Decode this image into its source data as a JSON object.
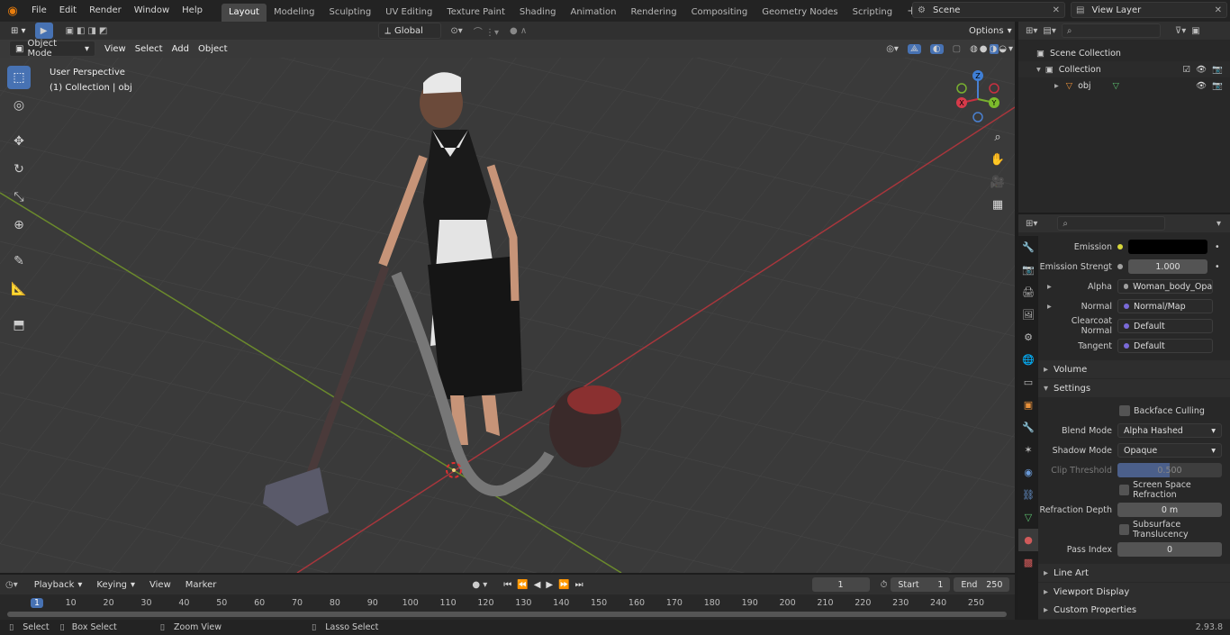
{
  "menubar": {
    "items": [
      "File",
      "Edit",
      "Render",
      "Window",
      "Help"
    ],
    "workspaces": [
      "Layout",
      "Modeling",
      "Sculpting",
      "UV Editing",
      "Texture Paint",
      "Shading",
      "Animation",
      "Rendering",
      "Compositing",
      "Geometry Nodes",
      "Scripting"
    ],
    "active_workspace": "Layout",
    "scene": "Scene",
    "view_layer": "View Layer"
  },
  "viewport": {
    "mode": "Object Mode",
    "menus": [
      "View",
      "Select",
      "Add",
      "Object"
    ],
    "transform_orientation": "Global",
    "options_label": "Options",
    "overlay_title": "User Perspective",
    "overlay_subtitle": "(1) Collection | obj",
    "gizmo": {
      "x": "X",
      "y": "Y",
      "z": "Z"
    }
  },
  "outliner": {
    "rows": [
      "Scene Collection",
      "Collection",
      "obj"
    ]
  },
  "properties": {
    "rows": [
      {
        "label": "Emission",
        "value": ""
      },
      {
        "label": "Emission Strengt",
        "value": "1.000"
      },
      {
        "label": "Alpha",
        "value": "Woman_body_Opac..."
      },
      {
        "label": "Normal",
        "value": "Normal/Map"
      },
      {
        "label": "Clearcoat Normal",
        "value": "Default"
      },
      {
        "label": "Tangent",
        "value": "Default"
      }
    ],
    "sections": {
      "volume": "Volume",
      "settings": "Settings",
      "line_art": "Line Art",
      "viewport_display": "Viewport Display",
      "custom_properties": "Custom Properties"
    },
    "backface_culling": "Backface Culling",
    "blend_mode_label": "Blend Mode",
    "blend_mode": "Alpha Hashed",
    "shadow_mode_label": "Shadow Mode",
    "shadow_mode": "Opaque",
    "clip_threshold_label": "Clip Threshold",
    "clip_threshold": "0.500",
    "ssr": "Screen Space Refraction",
    "refraction_depth_label": "Refraction Depth",
    "refraction_depth": "0 m",
    "subsurface": "Subsurface Translucency",
    "pass_index_label": "Pass Index",
    "pass_index": "0"
  },
  "timeline": {
    "menus": [
      "Playback",
      "Keying",
      "View",
      "Marker"
    ],
    "current_frame": "1",
    "start_label": "Start",
    "start": "1",
    "end_label": "End",
    "end": "250",
    "ticks": [
      "1",
      "10",
      "20",
      "30",
      "40",
      "50",
      "60",
      "70",
      "80",
      "90",
      "100",
      "110",
      "120",
      "130",
      "140",
      "150",
      "160",
      "170",
      "180",
      "190",
      "200",
      "210",
      "220",
      "230",
      "240",
      "250"
    ]
  },
  "status": {
    "select": "Select",
    "box_select": "Box Select",
    "zoom_view": "Zoom View",
    "lasso_select": "Lasso Select",
    "version": "2.93.8"
  }
}
